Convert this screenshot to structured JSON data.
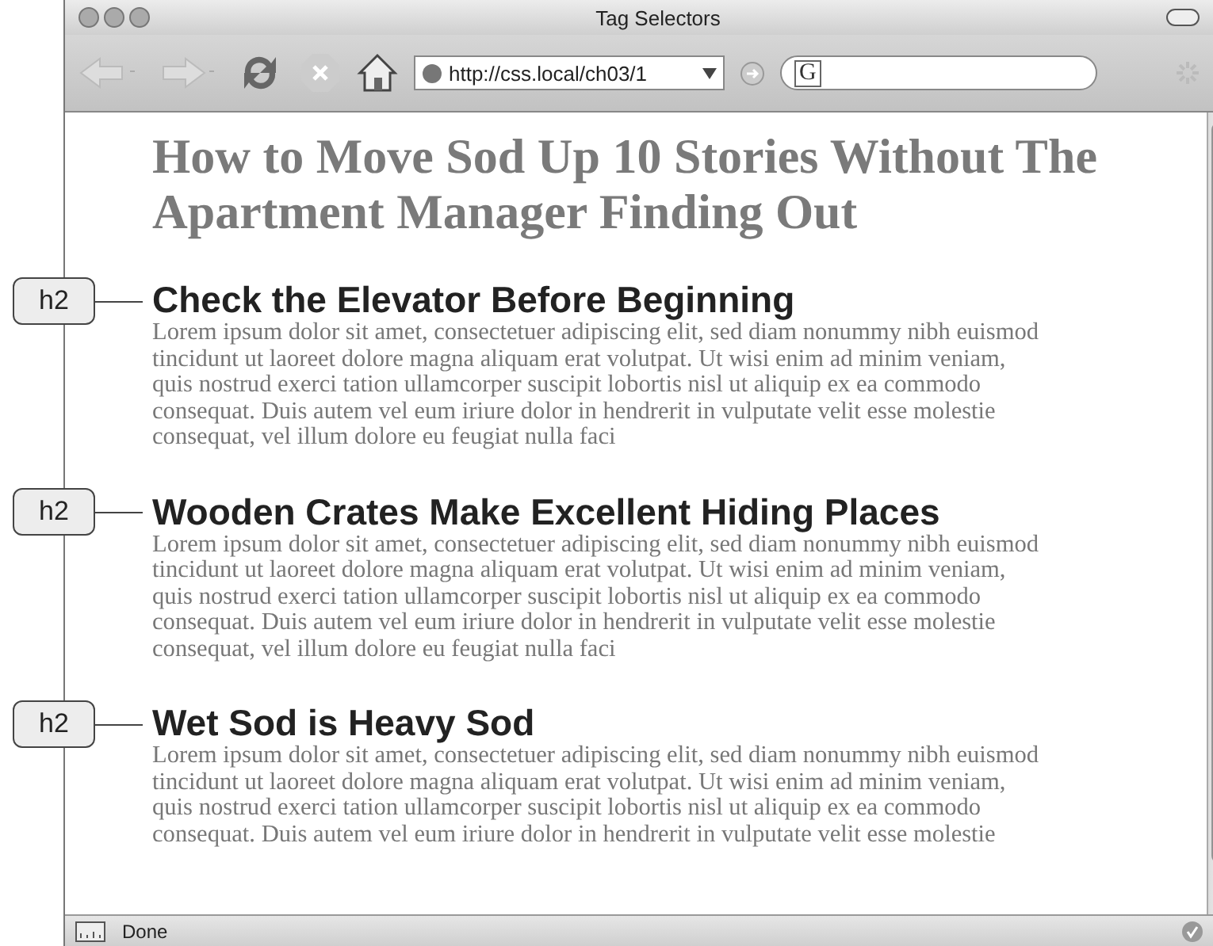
{
  "window": {
    "title": "Tag Selectors"
  },
  "toolbar": {
    "url": "http://css.local/ch03/1",
    "search_engine": "G"
  },
  "page": {
    "heading": "How to Move Sod Up 10 Stories Without The Apartment Manager Finding Out",
    "sections": [
      {
        "annotation": "h2",
        "heading": "Check the Elevator Before Beginning",
        "paragraph_lines": [
          "Lorem ipsum dolor sit amet, consectetuer adipiscing elit, sed diam nonummy nibh euismod",
          "tincidunt ut laoreet dolore magna aliquam erat volutpat. Ut wisi enim ad minim veniam,",
          "quis nostrud exerci tation ullamcorper suscipit lobortis nisl ut aliquip ex ea commodo",
          "consequat. Duis autem vel eum iriure dolor in hendrerit in vulputate velit esse molestie",
          "consequat, vel illum dolore eu feugiat nulla faci"
        ]
      },
      {
        "annotation": "h2",
        "heading": "Wooden Crates Make Excellent Hiding Places",
        "paragraph_lines": [
          "Lorem ipsum dolor sit amet, consectetuer adipiscing elit, sed diam nonummy nibh euismod",
          "tincidunt ut laoreet dolore magna aliquam erat volutpat. Ut wisi enim ad minim veniam,",
          "quis nostrud exerci tation ullamcorper suscipit lobortis nisl ut aliquip ex ea commodo",
          "consequat. Duis autem vel eum iriure dolor in hendrerit in vulputate velit esse molestie",
          "consequat, vel illum dolore eu feugiat nulla faci"
        ]
      },
      {
        "annotation": "h2",
        "heading": "Wet Sod is Heavy Sod",
        "paragraph_lines": [
          "Lorem ipsum dolor sit amet, consectetuer adipiscing elit, sed diam nonummy nibh euismod",
          "tincidunt ut laoreet dolore magna aliquam erat volutpat. Ut wisi enim ad minim veniam,",
          "quis nostrud exerci tation ullamcorper suscipit lobortis nisl ut aliquip ex ea commodo",
          "consequat. Duis autem vel eum iriure dolor in hendrerit in vulputate velit esse molestie"
        ]
      }
    ]
  },
  "status_bar": {
    "text": "Done"
  }
}
